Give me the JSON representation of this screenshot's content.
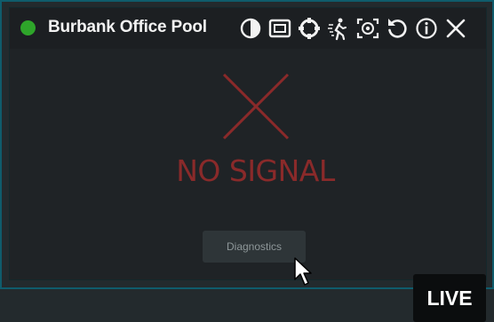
{
  "camera": {
    "title": "Burbank Office Pool",
    "status_color": "#2ea52a",
    "status": "online"
  },
  "toolbar": {
    "icons": [
      "contrast-icon",
      "picture-in-picture-icon",
      "ptz-crosshair-icon",
      "motion-detection-icon",
      "snapshot-focus-icon",
      "refresh-icon",
      "info-icon",
      "close-icon"
    ]
  },
  "video": {
    "message": "NO SIGNAL",
    "message_color": "#8a2a2a",
    "diagnostics_label": "Diagnostics",
    "live_label": "LIVE"
  },
  "colors": {
    "border_accent": "#0f5c6c",
    "background": "#1f2326"
  }
}
